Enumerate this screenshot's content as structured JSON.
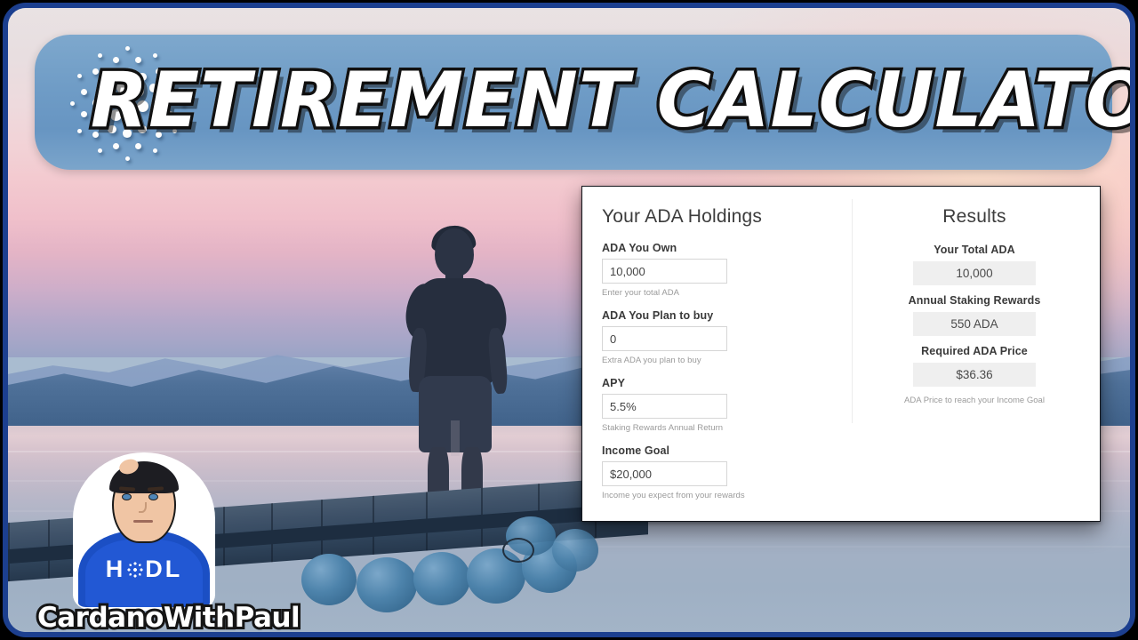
{
  "banner": {
    "title": "RETIREMENT  CALCULATOR",
    "logo_icon": "cardano-logo-icon",
    "background_color": "#6f9cc6"
  },
  "background": {
    "scene": "sunset-lake-dock-photo",
    "description": "Man standing on a floating dock at sunset looking at mountains"
  },
  "calculator": {
    "holdings": {
      "heading": "Your ADA Holdings",
      "fields": [
        {
          "label": "ADA You Own",
          "value": "10,000",
          "placeholder": "10,000",
          "hint": "Enter your total ADA"
        },
        {
          "label": "ADA You Plan to buy",
          "value": "0",
          "placeholder": "0",
          "hint": "Extra ADA you plan to buy"
        },
        {
          "label": "APY",
          "value": "5.5%",
          "placeholder": "5.5%",
          "hint": "Staking Rewards Annual Return"
        },
        {
          "label": "Income Goal",
          "value": "$20,000",
          "placeholder": "$20,000",
          "hint": "Income you expect from your rewards"
        }
      ]
    },
    "results": {
      "heading": "Results",
      "items": [
        {
          "label": "Your Total ADA",
          "value": "10,000"
        },
        {
          "label": "Annual Staking Rewards",
          "value": "550 ADA"
        },
        {
          "label": "Required ADA Price",
          "value": "$36.36"
        }
      ],
      "hint": "ADA Price to reach your Income Goal"
    }
  },
  "watermark": {
    "shirt_text_left": "H",
    "shirt_text_right": "DL",
    "shirt_logo_icon": "cardano-logo-icon",
    "channel_name": "CardanoWithPaul"
  },
  "colors": {
    "frame_border": "#1c3f8f",
    "banner_blue": "#6f9cc6",
    "shirt_blue": "#1b4fc4",
    "result_chip": "#efefef"
  }
}
